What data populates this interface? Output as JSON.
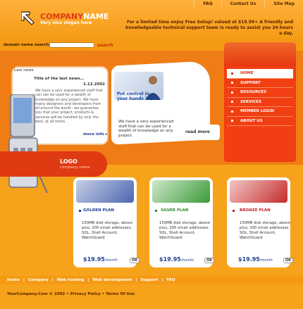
{
  "header": {
    "top_links": [
      "FAQ",
      "Contact Us",
      "Site Map"
    ],
    "company_a": "COMPANY",
    "company_b": "NAME",
    "slogan": "Very nice slogan here",
    "promo": "For a limited time enjoy Free Setup! valued at $19.99+ A friendly and knowledgeable technical support team is ready to assist you 24 hours a day."
  },
  "domain": {
    "label": "domain name search:",
    "button": "search"
  },
  "menu": [
    "HOME",
    "SUPPORT",
    "RESOURCES",
    "SERVICES",
    "MEMBER LOGIN",
    "ABOUT US"
  ],
  "news": {
    "label": "Last news",
    "title": "Title of the last news...",
    "date": "1.12.2002",
    "body": "We have a very experienced staff that can can be used for a wealth of knowledge on any project. We have many designers and developers from all around the world - we guarantee you that your project, products & services will be handled by only the best, at all times.",
    "more": "more info"
  },
  "feature": {
    "title": "Put control in your hands 24/7!",
    "body": "We have a very experienced staff that can be used for a wealth of knowledge on any project.",
    "read_more": "read more"
  },
  "logo": {
    "title": "LOGO",
    "sub": "company name"
  },
  "plans": [
    {
      "name": "GOLDEN PLAN",
      "body": "150MB disk storage, above plus, 200 email addresses, SQL, Shell Account, WatchGuard",
      "price": "$19.95",
      "per": "/month",
      "ok": "OK",
      "color": "#1d3d8a"
    },
    {
      "name": "SILVER PLAN",
      "body": "150MB disk storage, above plus, 200 email addresses, SQL, Shell Account, WatchGuard",
      "price": "$19.95",
      "per": "/month",
      "ok": "OK",
      "color": "#2a8a2a"
    },
    {
      "name": "BRONZE PLAN",
      "body": "150MB disk storage, above plus, 200 email addresses, SQL, Shell Account, WatchGuard",
      "price": "$19.95",
      "per": "/month",
      "ok": "OK",
      "color": "#c42020"
    }
  ],
  "nav": [
    "Home",
    "|",
    "Company",
    "|",
    "Web hosting",
    "|",
    "Web development",
    "|",
    "Support",
    "|",
    "FAQ"
  ],
  "footer": {
    "copyright": "YourCompany.Com © 2002 • Privacy Policy • Terms Of Use"
  }
}
